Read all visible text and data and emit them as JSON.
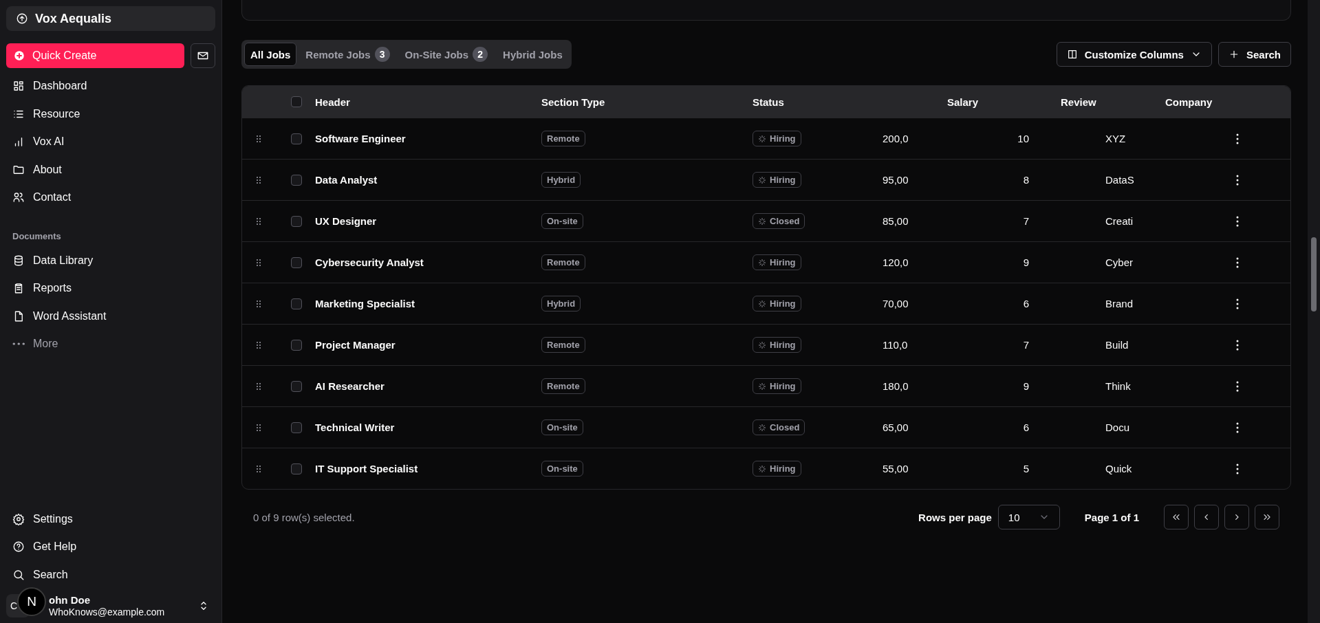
{
  "sidebar": {
    "brand": "Vox Aequalis",
    "quick_create": "Quick Create",
    "nav_items": [
      {
        "label": "Dashboard"
      },
      {
        "label": "Resource"
      },
      {
        "label": "Vox AI"
      },
      {
        "label": "About"
      },
      {
        "label": "Contact"
      }
    ],
    "documents_heading": "Documents",
    "document_items": [
      {
        "label": "Data Library"
      },
      {
        "label": "Reports"
      },
      {
        "label": "Word Assistant"
      }
    ],
    "more": "More",
    "footer_items": [
      {
        "label": "Settings"
      },
      {
        "label": "Get Help"
      },
      {
        "label": "Search"
      }
    ],
    "user": {
      "avatar": "C",
      "name": "ohn Doe",
      "email": "WhoKnows@example.com"
    },
    "dev_badge": "N"
  },
  "tabs": [
    {
      "label": "All Jobs",
      "selected": true
    },
    {
      "label": "Remote Jobs",
      "count": "3",
      "selected": false
    },
    {
      "label": "On-Site Jobs",
      "count": "2",
      "selected": false
    },
    {
      "label": "Hybrid Jobs",
      "selected": false
    }
  ],
  "toolbar": {
    "customize": "Customize Columns",
    "search": "Search"
  },
  "table": {
    "columns": [
      "Header",
      "Section Type",
      "Status",
      "Salary",
      "Review",
      "Company"
    ],
    "header_checked": false,
    "rows": [
      {
        "checked": false,
        "header": "Software Engineer",
        "section_type": "Remote",
        "status": "Hiring",
        "salary": "200,0",
        "review": "10",
        "company": "XYZ"
      },
      {
        "checked": false,
        "header": "Data Analyst",
        "section_type": "Hybrid",
        "status": "Hiring",
        "salary": "95,00",
        "review": "8",
        "company": "DataS"
      },
      {
        "checked": false,
        "header": "UX Designer",
        "section_type": "On-site",
        "status": "Closed",
        "salary": "85,00",
        "review": "7",
        "company": "Creati"
      },
      {
        "checked": false,
        "header": "Cybersecurity Analyst",
        "section_type": "Remote",
        "status": "Hiring",
        "salary": "120,0",
        "review": "9",
        "company": "Cyber"
      },
      {
        "checked": false,
        "header": "Marketing Specialist",
        "section_type": "Hybrid",
        "status": "Hiring",
        "salary": "70,00",
        "review": "6",
        "company": "Brand"
      },
      {
        "checked": false,
        "header": "Project Manager",
        "section_type": "Remote",
        "status": "Hiring",
        "salary": "110,0",
        "review": "7",
        "company": "Build"
      },
      {
        "checked": false,
        "header": "AI Researcher",
        "section_type": "Remote",
        "status": "Hiring",
        "salary": "180,0",
        "review": "9",
        "company": "Think"
      },
      {
        "checked": false,
        "header": "Technical Writer",
        "section_type": "On-site",
        "status": "Closed",
        "salary": "65,00",
        "review": "6",
        "company": "Docu"
      },
      {
        "checked": false,
        "header": "IT Support Specialist",
        "section_type": "On-site",
        "status": "Hiring",
        "salary": "55,00",
        "review": "5",
        "company": "Quick"
      }
    ]
  },
  "footer": {
    "selection": "0 of 9 row(s) selected.",
    "rows_per_page_label": "Rows per page",
    "rows_per_page": "10",
    "page": "Page 1 of 1"
  }
}
